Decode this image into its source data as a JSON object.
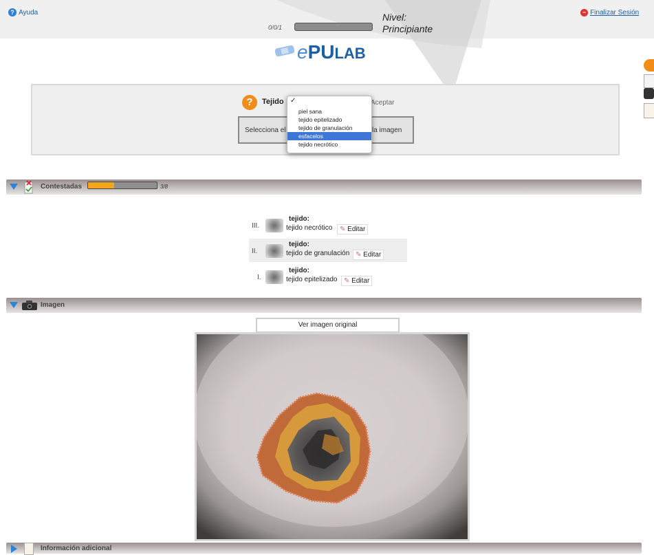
{
  "topbar": {
    "help_label": "Ayuda",
    "logout_label": "Finalizar Sesión",
    "level_label": "Nivel:",
    "level_value": "Principiante",
    "score_text": "0/0/1",
    "score_progress": 0.0
  },
  "logo": {
    "e": "e",
    "pu": "PU",
    "lab": "LAB"
  },
  "question": {
    "label": "Tejido",
    "accept_label": "Aceptar",
    "instruction_left": "Selecciona el",
    "instruction_right": "la imagen",
    "dropdown": {
      "check": "✓",
      "options": [
        "piel sana",
        "tejido epitelizado",
        "tejido de granulación",
        "esfacelos",
        "tejido necrótico"
      ],
      "highlighted": "esfacelos"
    }
  },
  "answered": {
    "title": "Contestadas",
    "count_text": "3/8",
    "progress": 0.375,
    "items": [
      {
        "num": "III.",
        "label": "tejido:",
        "value": "tejido necrótico",
        "edit": "Editar"
      },
      {
        "num": "II.",
        "label": "tejido:",
        "value": "tejido de granulación",
        "edit": "Editar"
      },
      {
        "num": "I.",
        "label": "tejido:",
        "value": "tejido epitelizado",
        "edit": "Editar"
      }
    ]
  },
  "image_section": {
    "title": "Imagen",
    "view_original": "Ver imagen original"
  },
  "extra_section": {
    "title": "Información adicional"
  },
  "colors": {
    "accent_blue": "#2a84db",
    "progress_orange": "#f3a51b",
    "selection_blue": "#3e76d8"
  }
}
